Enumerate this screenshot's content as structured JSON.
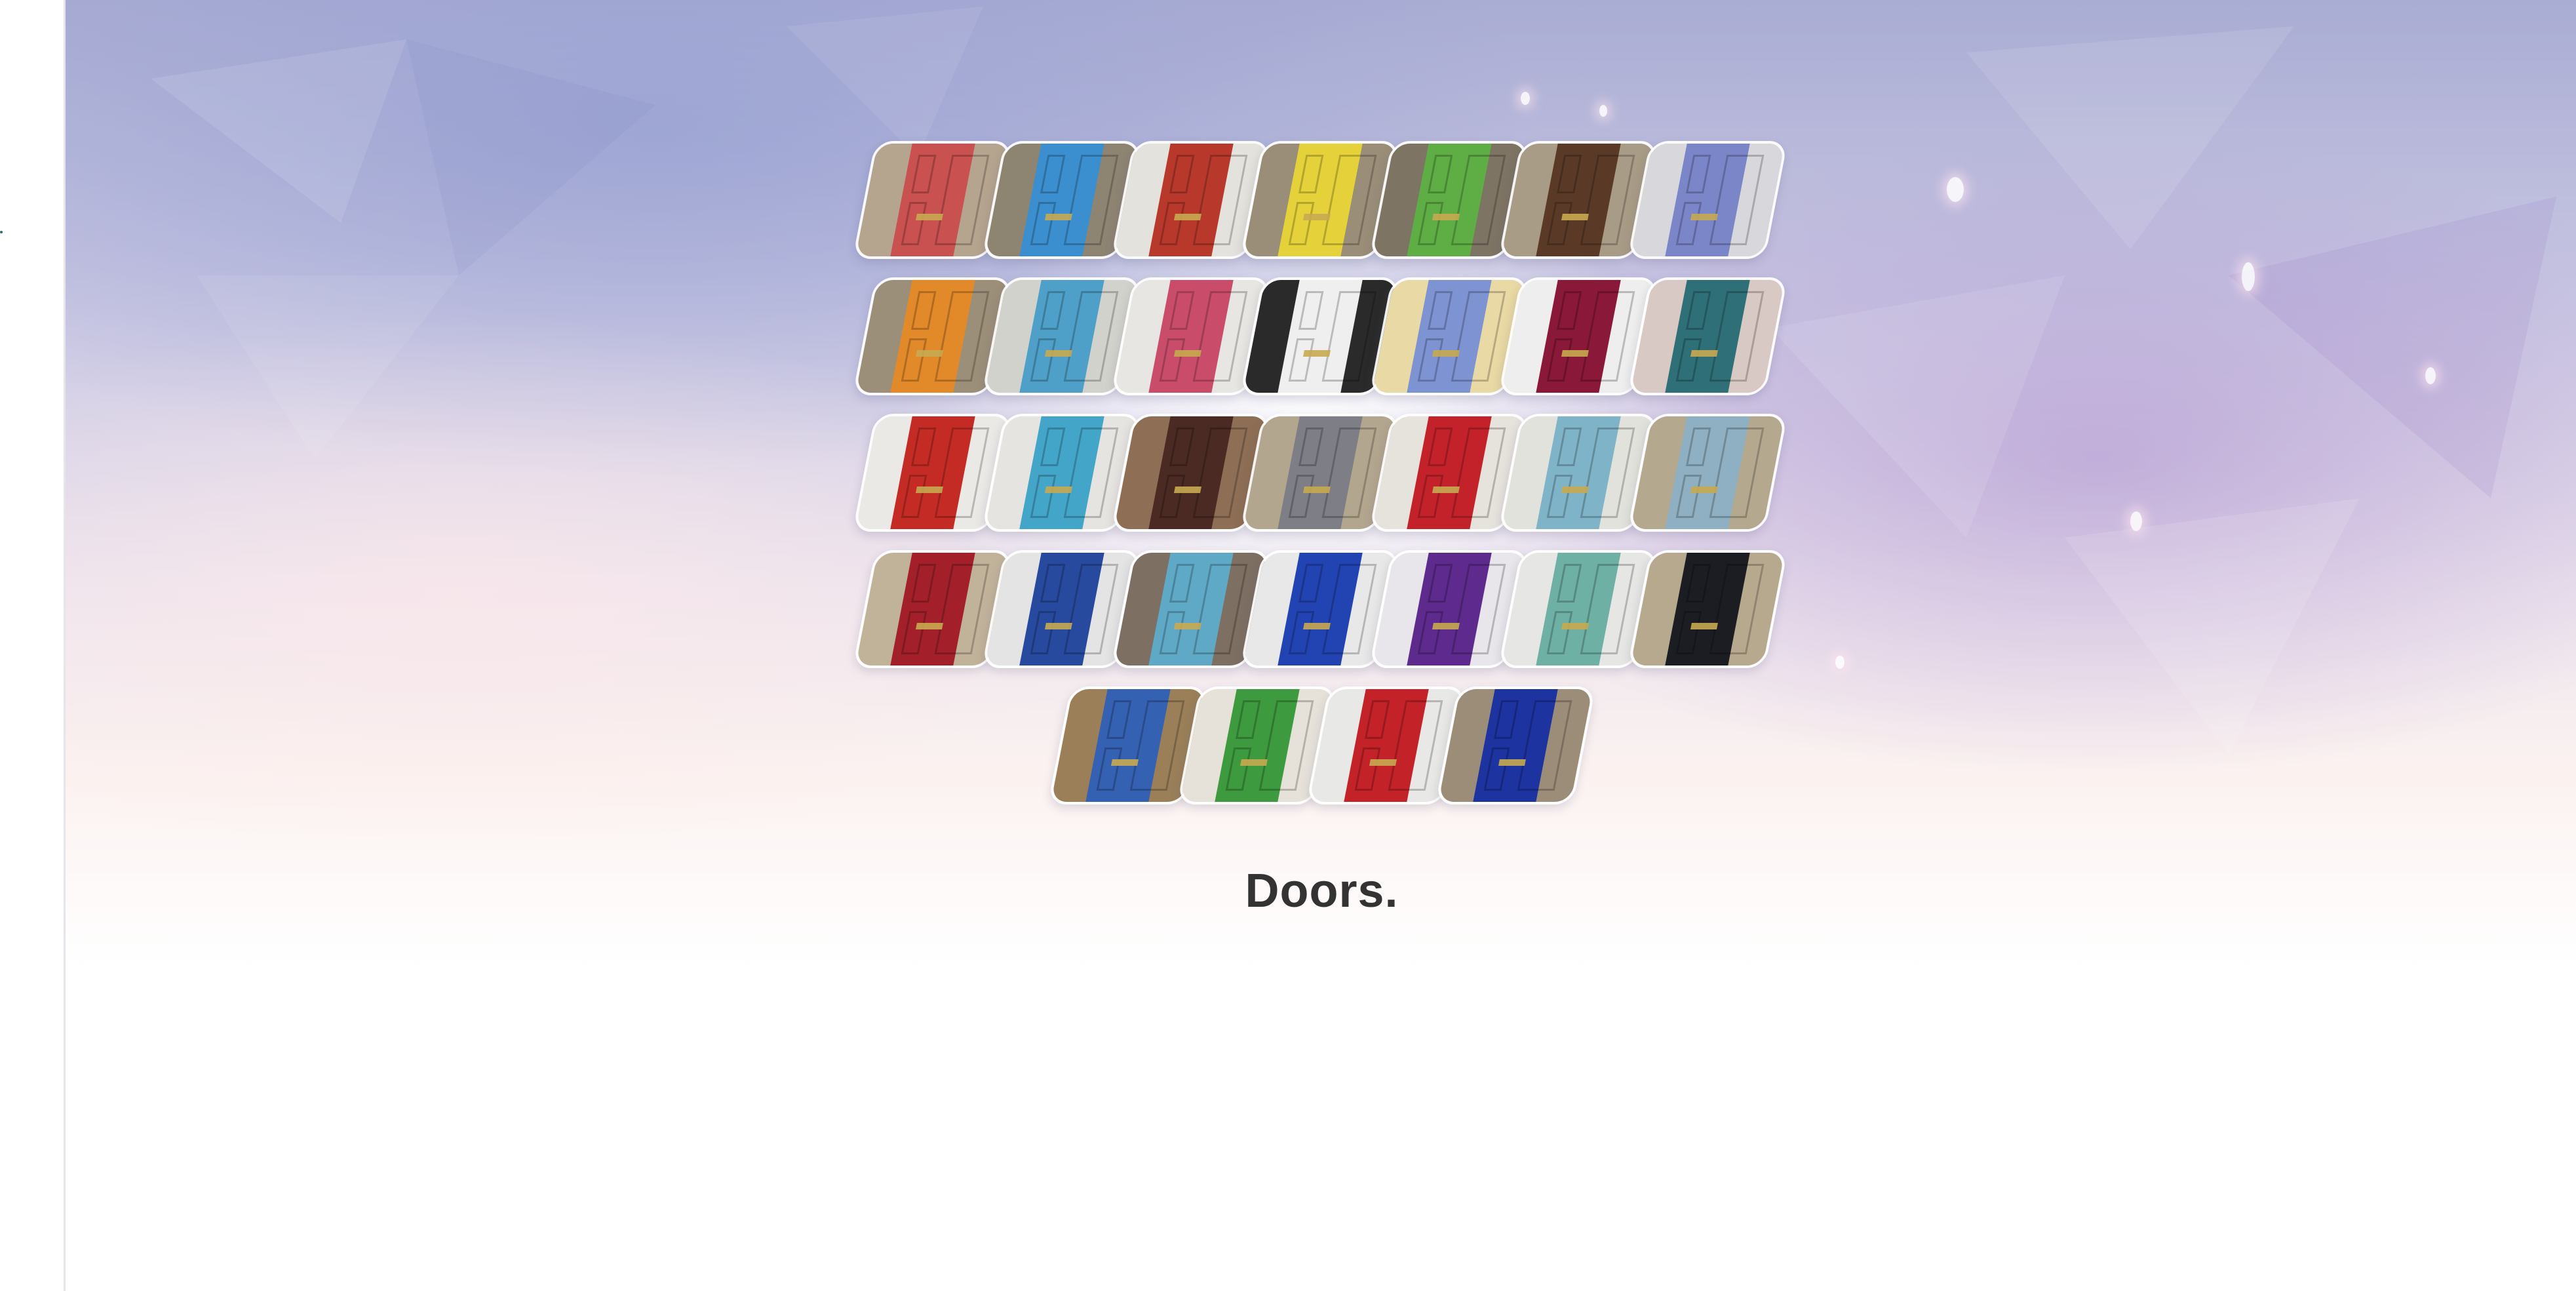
{
  "title": "Doors.",
  "doors": [
    {
      "name": "door-red-window",
      "color": "#c9514f",
      "wall": "#b5a48e"
    },
    {
      "name": "door-light-blue",
      "color": "#3b8fcf",
      "wall": "#8e8472"
    },
    {
      "name": "door-red",
      "color": "#b8392c",
      "wall": "#e4e2dc"
    },
    {
      "name": "door-yellow",
      "color": "#e5d23a",
      "wall": "#9a8e78"
    },
    {
      "name": "door-green",
      "color": "#5fae45",
      "wall": "#7d7464"
    },
    {
      "name": "door-brown",
      "color": "#5a3a27",
      "wall": "#a89c86"
    },
    {
      "name": "door-lavender",
      "color": "#7b86c9",
      "wall": "#d8d8dc"
    },
    {
      "name": "door-orange",
      "color": "#e28a2a",
      "wall": "#9c8f79"
    },
    {
      "name": "door-sky-blue",
      "color": "#4ea0c8",
      "wall": "#d2d2cc"
    },
    {
      "name": "door-pink",
      "color": "#c94d6a",
      "wall": "#e8e6e2"
    },
    {
      "name": "door-white",
      "color": "#efefef",
      "wall": "#2a2a2a"
    },
    {
      "name": "door-periwinkle",
      "color": "#7d93d2",
      "wall": "#e9d9a4"
    },
    {
      "name": "door-burgundy",
      "color": "#8a1838",
      "wall": "#efeeee"
    },
    {
      "name": "door-teal",
      "color": "#2f6f78",
      "wall": "#d9c9c4"
    },
    {
      "name": "door-red-glass",
      "color": "#c42b24",
      "wall": "#ebe9e6"
    },
    {
      "name": "door-turquoise",
      "color": "#43a6c9",
      "wall": "#e6e4e0"
    },
    {
      "name": "door-dark-brown",
      "color": "#4a2a22",
      "wall": "#8e6e54"
    },
    {
      "name": "door-grey",
      "color": "#7d7e86",
      "wall": "#b3a68f"
    },
    {
      "name": "door-red-arched",
      "color": "#c4222a",
      "wall": "#e6e2dc"
    },
    {
      "name": "door-pale-blue-glass",
      "color": "#7fb3c7",
      "wall": "#e2e2dc"
    },
    {
      "name": "door-slate-blue",
      "color": "#8fb0c2",
      "wall": "#b4a98f"
    },
    {
      "name": "door-deep-red",
      "color": "#a3202a",
      "wall": "#c1b39a"
    },
    {
      "name": "door-navy-lifebuoy",
      "color": "#274a9e",
      "wall": "#e4e4e4"
    },
    {
      "name": "door-aqua-lattice",
      "color": "#5fa9c6",
      "wall": "#7d6f62"
    },
    {
      "name": "door-royal-blue",
      "color": "#2244b3",
      "wall": "#e8e8e8"
    },
    {
      "name": "door-purple",
      "color": "#5e2a8e",
      "wall": "#e8e6ea"
    },
    {
      "name": "door-mint",
      "color": "#6fb0a4",
      "wall": "#e6e6e4"
    },
    {
      "name": "door-black",
      "color": "#1c1d22",
      "wall": "#b6a98e"
    },
    {
      "name": "door-cobalt",
      "color": "#3561b3",
      "wall": "#9a7f59"
    },
    {
      "name": "door-emerald",
      "color": "#3d9a3e",
      "wall": "#e6e2da"
    },
    {
      "name": "door-scarlet",
      "color": "#c32228",
      "wall": "#e8e8e6"
    },
    {
      "name": "door-ultramarine",
      "color": "#1c33a0",
      "wall": "#9c8d78"
    }
  ]
}
